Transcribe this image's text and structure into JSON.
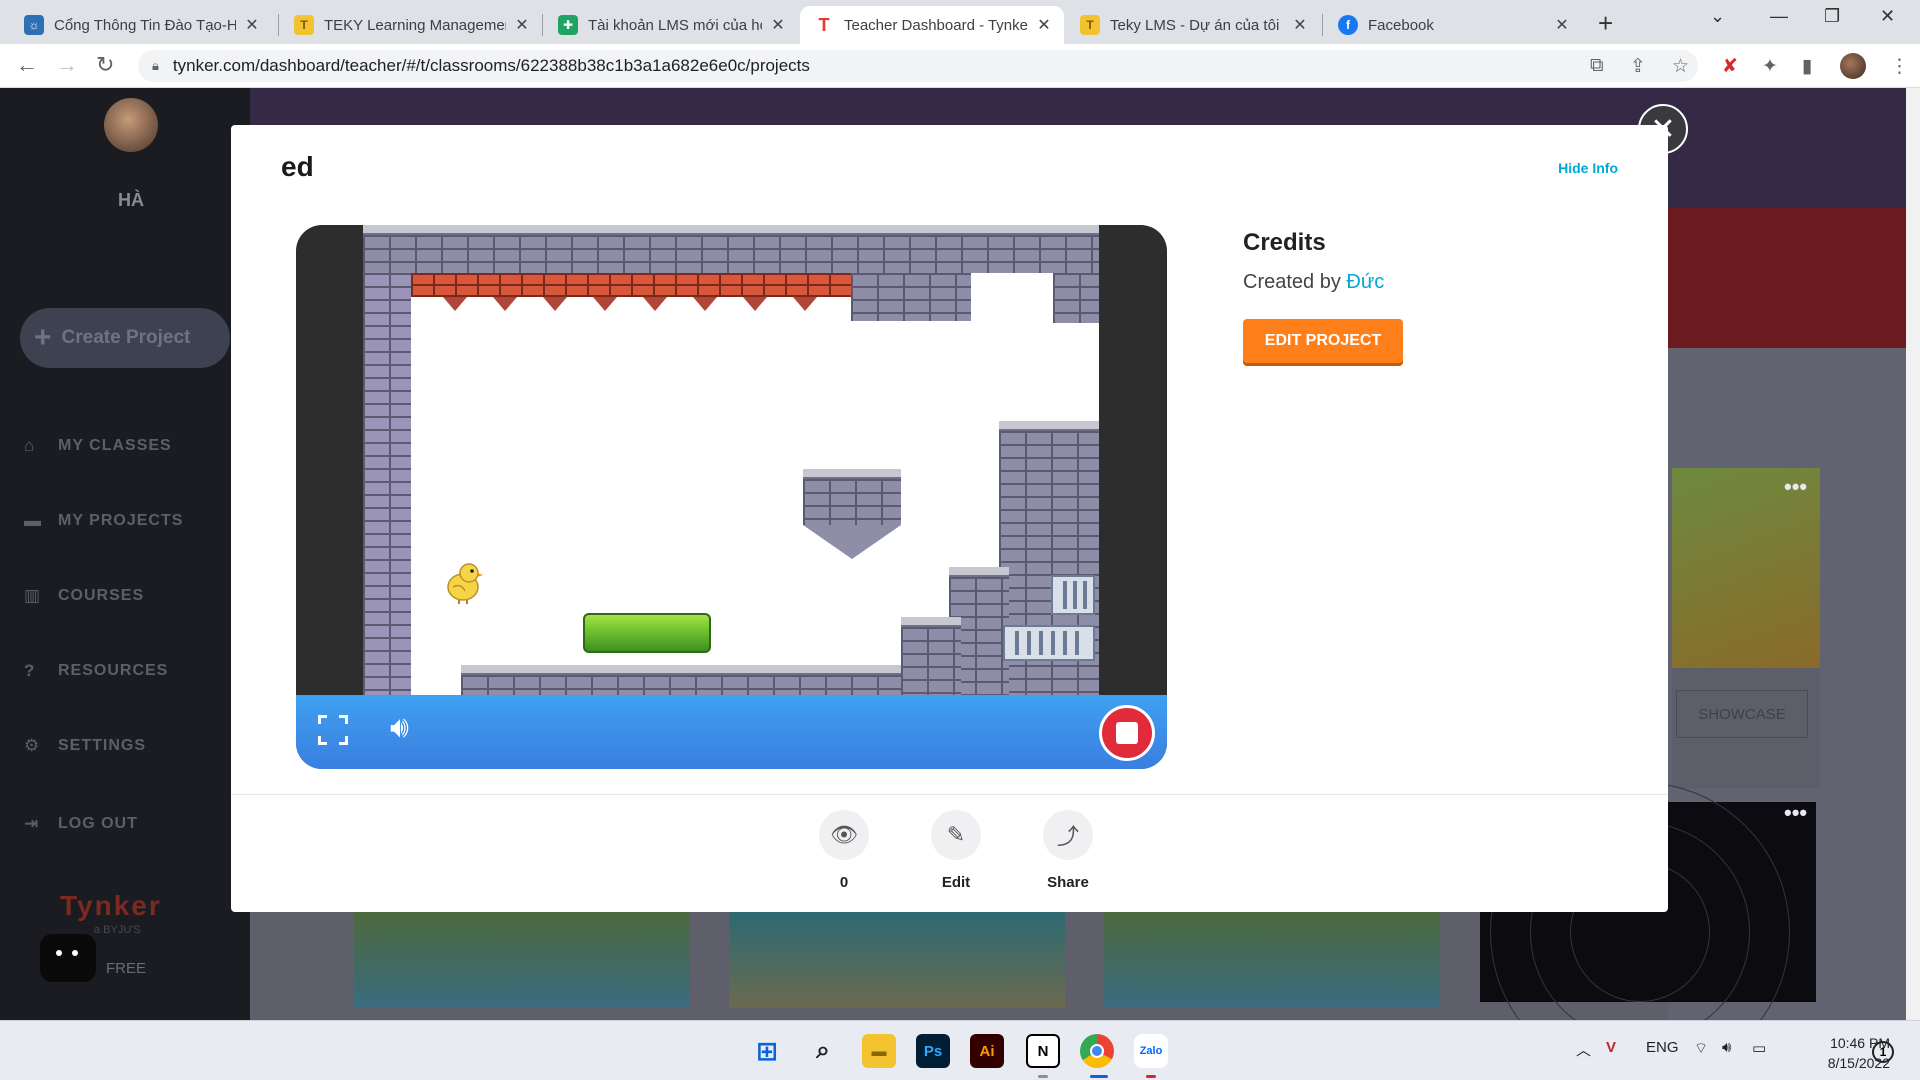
{
  "browser": {
    "tabs": [
      {
        "title": "Cổng Thông Tin Đào Tạo-H",
        "favicon": "school-icon",
        "color": "#2f6fb3"
      },
      {
        "title": "TEKY Learning Managemen",
        "favicon": "teky-icon",
        "color": "#f2c230"
      },
      {
        "title": "Tài khoản LMS mới của học",
        "favicon": "sheets-icon",
        "color": "#1fa463"
      },
      {
        "title": "Teacher Dashboard - Tynker",
        "favicon": "tynker-icon",
        "color": "#e43b2c"
      },
      {
        "title": "Teky LMS - Dự án của tôi",
        "favicon": "teky-icon",
        "color": "#f2c230"
      },
      {
        "title": "Facebook",
        "favicon": "facebook-icon",
        "color": "#1877f2"
      }
    ],
    "url": "tynker.com/dashboard/teacher/#/t/classrooms/622388b38c1b3a1a682e6e0c/projects"
  },
  "sidebar": {
    "user_name": "HÀ",
    "create_label": "Create Project",
    "items": [
      {
        "label": "MY CLASSES",
        "icon": "home-icon"
      },
      {
        "label": "MY PROJECTS",
        "icon": "folder-icon"
      },
      {
        "label": "COURSES",
        "icon": "book-icon"
      },
      {
        "label": "RESOURCES",
        "icon": "help-icon"
      },
      {
        "label": "SETTINGS",
        "icon": "gear-icon"
      },
      {
        "label": "LOG OUT",
        "icon": "logout-icon"
      }
    ],
    "logo": "Tynker",
    "logo_sub": "a BYJU'S",
    "plan": "FREE"
  },
  "background": {
    "showcase_label": "SHOWCASE",
    "menu_dots": "•••"
  },
  "modal": {
    "title": "ed",
    "hide_info": "Hide Info",
    "credits_title": "Credits",
    "created_by_prefix": "Created by",
    "author": "Đức",
    "edit_project": "EDIT PROJECT",
    "actions": [
      {
        "label": "0",
        "icon": "eye-icon"
      },
      {
        "label": "Edit",
        "icon": "pencil-icon"
      },
      {
        "label": "Share",
        "icon": "share-icon"
      }
    ],
    "player": {
      "fullscreen": "fullscreen-icon",
      "volume": "volume-icon",
      "stop": "stop-icon",
      "accent": "#3a8ff0",
      "stop_color": "#e02c3a"
    }
  },
  "taskbar": {
    "apps": [
      "windows-start-icon",
      "search-icon",
      "file-explorer-icon",
      "photoshop-icon",
      "illustrator-icon",
      "notion-icon",
      "chrome-icon",
      "zalo-icon"
    ],
    "language": "ENG",
    "time": "10:46 PM",
    "date": "8/15/2022",
    "notification_count": "1"
  }
}
